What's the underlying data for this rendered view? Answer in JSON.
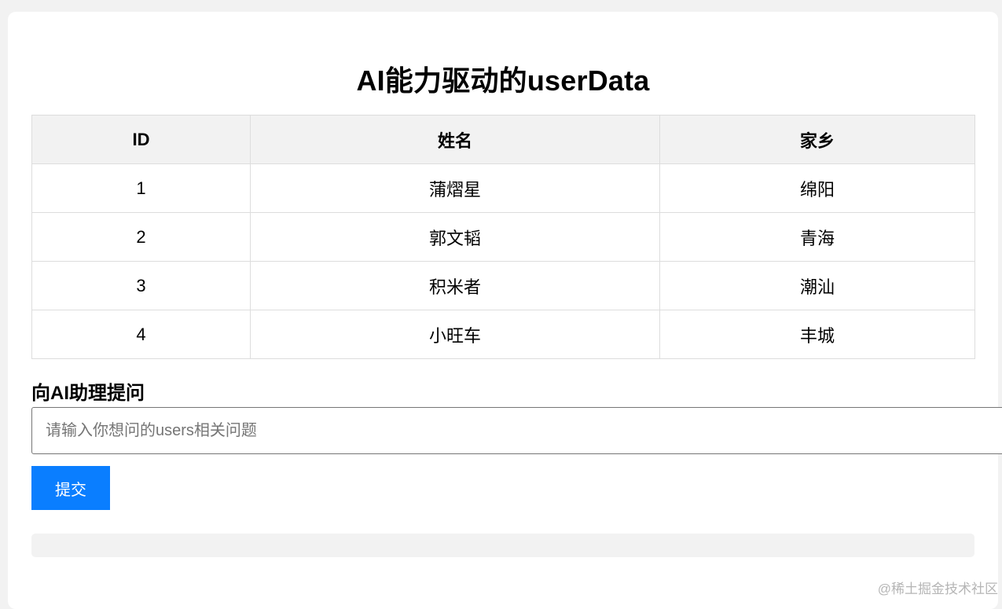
{
  "page": {
    "title": "AI能力驱动的userData"
  },
  "table": {
    "headers": [
      "ID",
      "姓名",
      "家乡"
    ],
    "rows": [
      {
        "id": "1",
        "name": "蒲熠星",
        "hometown": "绵阳"
      },
      {
        "id": "2",
        "name": "郭文韬",
        "hometown": "青海"
      },
      {
        "id": "3",
        "name": "积米者",
        "hometown": "潮汕"
      },
      {
        "id": "4",
        "name": "小旺车",
        "hometown": "丰城"
      }
    ]
  },
  "ask": {
    "label": "向AI助理提问",
    "placeholder": "请输入你想问的users相关问题",
    "value": "",
    "submit_label": "提交"
  },
  "response": {
    "text": ""
  },
  "watermark": {
    "text": "@稀土掘金技术社区"
  },
  "colors": {
    "submit_button": "#0a7eff",
    "header_background": "#f2f2f2",
    "page_background": "#f2f2f2"
  }
}
